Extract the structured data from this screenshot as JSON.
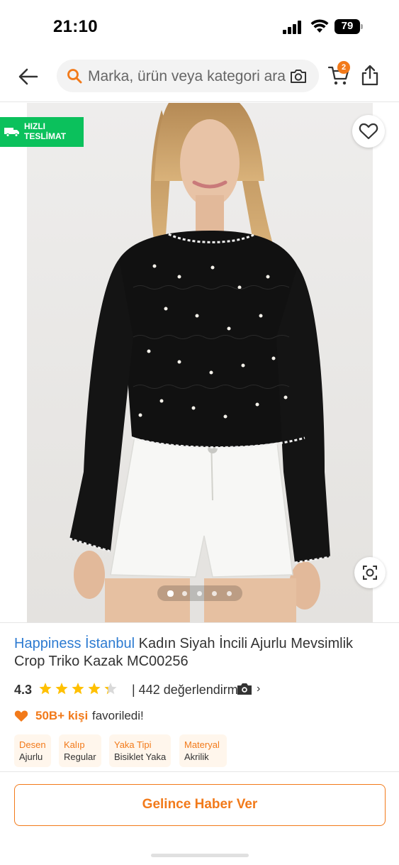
{
  "status_bar": {
    "time": "21:10",
    "battery": "79"
  },
  "header": {
    "search_placeholder": "Marka, ürün veya kategori ara",
    "cart_count": "2",
    "icons": [
      "back-arrow-icon",
      "search-icon",
      "camera-icon",
      "cart-icon",
      "share-icon"
    ]
  },
  "gallery": {
    "badge_line1": "HIZLI",
    "badge_line2": "TESLİMAT",
    "image_count": 5,
    "active_image": 1
  },
  "product": {
    "brand": "Happiness İstanbul",
    "name": "Kadın Siyah İncili Ajurlu Mevsimlik Crop Triko Kazak MC00256",
    "rating": "4.3",
    "rating_fraction": 0.86,
    "review_count": "| 442 değerlendirme"
  },
  "favorites": {
    "count": "50B+ kişi",
    "text": "favoriledi!"
  },
  "attributes": [
    {
      "name": "Desen",
      "value": "Ajurlu"
    },
    {
      "name": "Kalıp",
      "value": "Regular"
    },
    {
      "name": "Yaka Tipi",
      "value": "Bisiklet Yaka"
    },
    {
      "name": "Materyal",
      "value": "Akrilik"
    }
  ],
  "actions": {
    "notify_label": "Gelince Haber Ver"
  },
  "colors": {
    "accent": "#f27a1a",
    "brand_link": "#2d7bd1",
    "fast_delivery": "#0bc15c",
    "star": "#ffc000"
  }
}
